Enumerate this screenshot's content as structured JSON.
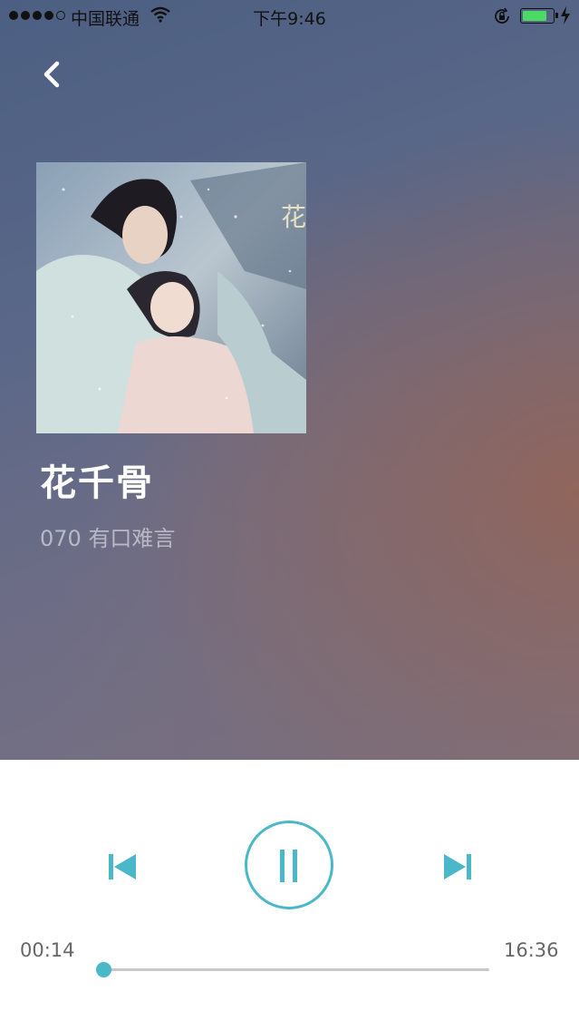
{
  "status_bar": {
    "carrier": "中国联通",
    "time": "下午9:46",
    "signal_bars_filled": 4,
    "signal_bars_total": 5,
    "battery_level": 0.8,
    "icons": [
      "signal-dots",
      "wifi-icon",
      "orientation-lock-icon",
      "battery-icon",
      "charging-bolt-icon"
    ]
  },
  "nav": {
    "back_icon": "chevron-left"
  },
  "now_playing": {
    "album_title": "花千骨",
    "episode": "070 有口难言"
  },
  "player": {
    "current_time": "00:14",
    "total_time": "16:36",
    "progress": 0.014,
    "state": "playing",
    "accent_color": "#4ab8c8",
    "icons": [
      "previous-icon",
      "pause-icon",
      "next-icon"
    ]
  }
}
